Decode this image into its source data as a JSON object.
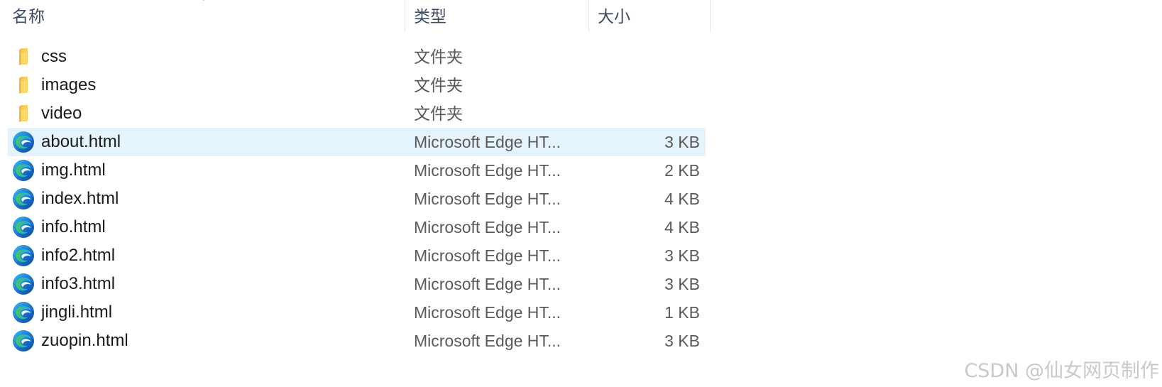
{
  "columns": {
    "name": "名称",
    "type": "类型",
    "size": "大小"
  },
  "files": [
    {
      "name": "css",
      "type": "文件夹",
      "size": "",
      "icon": "folder-icon"
    },
    {
      "name": "images",
      "type": "文件夹",
      "size": "",
      "icon": "folder-icon"
    },
    {
      "name": "video",
      "type": "文件夹",
      "size": "",
      "icon": "folder-icon"
    },
    {
      "name": "about.html",
      "type": "Microsoft Edge HT...",
      "size": "3 KB",
      "icon": "edge-icon",
      "selected": true
    },
    {
      "name": "img.html",
      "type": "Microsoft Edge HT...",
      "size": "2 KB",
      "icon": "edge-icon"
    },
    {
      "name": "index.html",
      "type": "Microsoft Edge HT...",
      "size": "4 KB",
      "icon": "edge-icon"
    },
    {
      "name": "info.html",
      "type": "Microsoft Edge HT...",
      "size": "4 KB",
      "icon": "edge-icon"
    },
    {
      "name": "info2.html",
      "type": "Microsoft Edge HT...",
      "size": "3 KB",
      "icon": "edge-icon"
    },
    {
      "name": "info3.html",
      "type": "Microsoft Edge HT...",
      "size": "3 KB",
      "icon": "edge-icon"
    },
    {
      "name": "jingli.html",
      "type": "Microsoft Edge HT...",
      "size": "1 KB",
      "icon": "edge-icon"
    },
    {
      "name": "zuopin.html",
      "type": "Microsoft Edge HT...",
      "size": "3 KB",
      "icon": "edge-icon"
    }
  ],
  "watermark": "CSDN @仙女网页制作",
  "colors": {
    "selected_row": "#e5f3fd",
    "folder": "#f8c848",
    "edge_blue": "#1a6fcf",
    "edge_green": "#3fc56b"
  }
}
